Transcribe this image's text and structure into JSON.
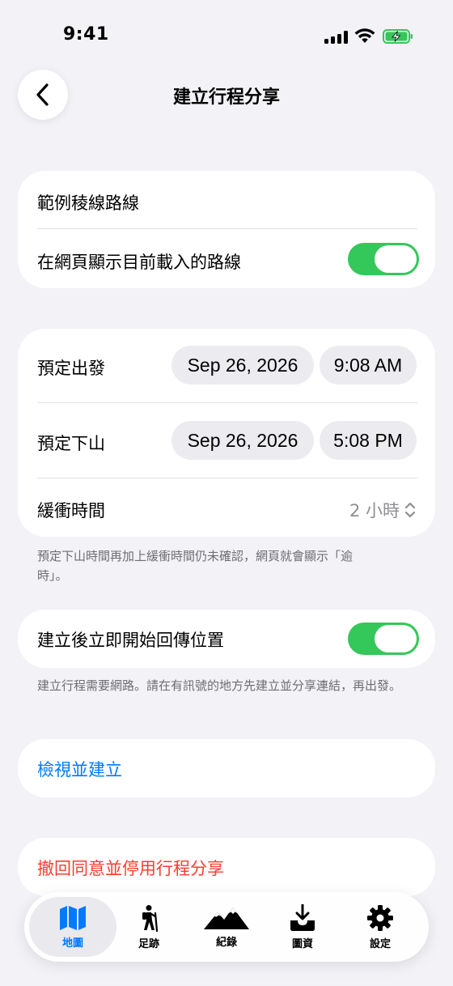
{
  "status_bar": {
    "time": "9:41"
  },
  "nav": {
    "title": "建立行程分享",
    "back_icon": "chevron-left-icon"
  },
  "route_card": {
    "route_name": "範例稜線路線",
    "show_route_label": "在網頁顯示目前載入的路線",
    "show_route_enabled": true
  },
  "schedule_card": {
    "departure_label": "預定出發",
    "departure_date": "Sep 26, 2026",
    "departure_time": "9:08 AM",
    "descent_label": "預定下山",
    "descent_date": "Sep 26, 2026",
    "descent_time": "5:08 PM",
    "buffer_label": "緩衝時間",
    "buffer_value": "2 小時"
  },
  "schedule_note": "預定下山時間再加上緩衝時間仍未確認，網頁就會顯示「逾時」。",
  "location_card": {
    "label": "建立後立即開始回傳位置",
    "enabled": true
  },
  "location_note": "建立行程需要網路。請在有訊號的地方先建立並分享連結，再出發。",
  "actions": {
    "review_create": "檢視並建立",
    "revoke": "撤回同意並停用行程分享"
  },
  "colors": {
    "accent": "#007aff",
    "toggle_on": "#34c759",
    "destructive": "#ff3b30",
    "background": "#f2f2f7"
  },
  "tab_bar": {
    "tabs": [
      {
        "label": "地圖",
        "icon": "map-icon",
        "active": true
      },
      {
        "label": "足跡",
        "icon": "hiker-icon",
        "active": false
      },
      {
        "label": "紀錄",
        "icon": "mountains-icon",
        "active": false
      },
      {
        "label": "圖資",
        "icon": "tray-download-icon",
        "active": false
      },
      {
        "label": "設定",
        "icon": "gear-icon",
        "active": false
      }
    ]
  }
}
